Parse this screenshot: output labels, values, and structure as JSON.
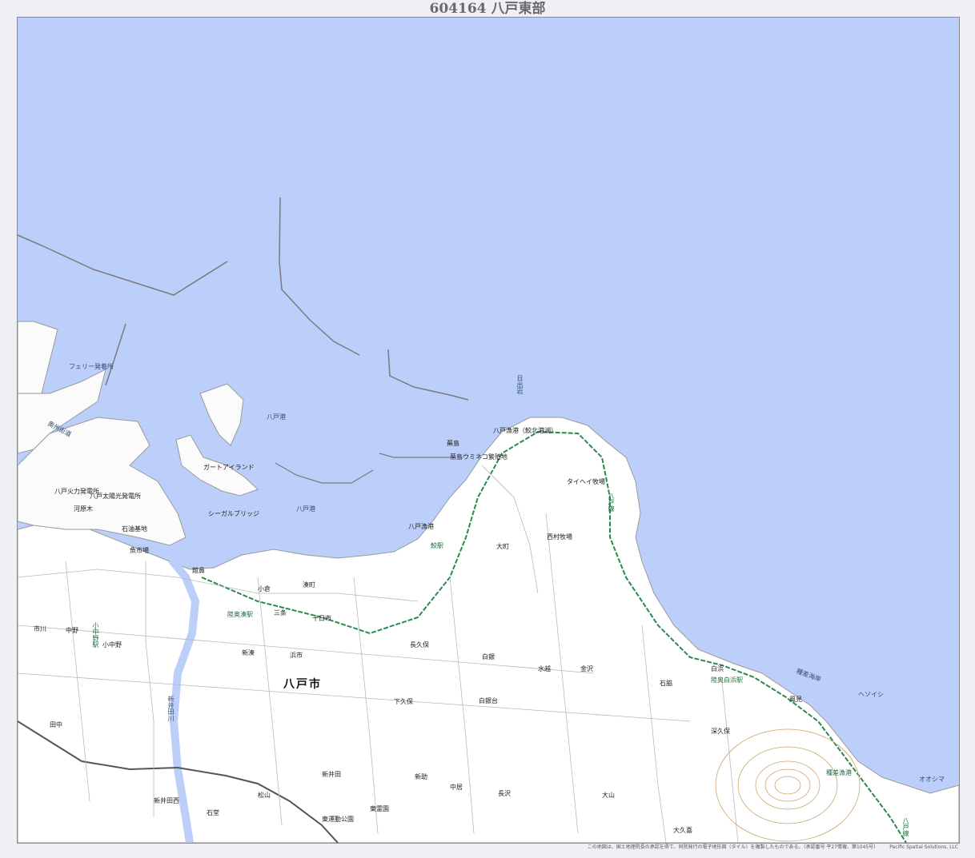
{
  "sheet": {
    "code": "604164",
    "name": "八戸東部"
  },
  "colors": {
    "sea": "#bccffb",
    "land": "#ffffff",
    "roads": "#9a9a9a",
    "railway": "#2b8a4e",
    "contours": "#c9a46a"
  },
  "labels": {
    "city": "八戸市",
    "hachinohe_port": "八戸港",
    "hachinohe_port2": "八戸港",
    "gate_island": "ガートアイランド",
    "seagull_bridge": "シーガルブリッジ",
    "ferry_terminal": "フェリー発着所",
    "kabushima": "蕪島",
    "kabushima_umineko": "蕪島ウミネコ繁殖地",
    "hachinohe_fishing_port_north": "八戸漁港（鮫北港湖）",
    "hachinohe_fishing_port_south": "八戸漁港",
    "hibiki": "日出岩",
    "hebiishi": "ヘソイシ",
    "oonishima": "オオシマ",
    "taipei_farm": "タイヘイ牧場",
    "nishimura_farm": "西村牧場",
    "tanesashi_coast": "種差海岸",
    "hachinohe_line_north": "八戸線",
    "hachinohe_line_south": "八戸線",
    "daikumaya": "大久喜",
    "samae_station": "鮫駅",
    "mutsuminato_station": "陸奥湊駅",
    "shirahama": "白浜",
    "mutsushirahama_station": "陸奥白浜駅",
    "isegamisaki": "石脇",
    "fukaho": "深久保",
    "hamachi": "浜市",
    "shinminato": "新湊",
    "minato": "湊町",
    "shirogane": "白銀",
    "shirogane_dai": "白銀台",
    "sanjo": "三条",
    "tosaka": "十日市",
    "nagawa": "長久保",
    "shimokubo": "下久保",
    "mizukoshi": "水越",
    "ooyama": "大山",
    "kanezawa": "金沢",
    "nakano": "中野",
    "konakano": "小中野",
    "konakano_station": "小中野駅",
    "shinmachi": "新井田",
    "shimoinuzawa": "新井田西",
    "matsuyama": "松山",
    "ishido": "石堂",
    "higashi_park": "東運動公園",
    "toei_park": "東霊園",
    "hachinohe_power": "八戸火力発電所",
    "taiheiyo_power": "八戸太陽光発電所",
    "sekiyu": "石油基地",
    "gyoshi": "魚市場",
    "tako": "館鼻",
    "kokura": "小倉",
    "mutsu_line": "奥州街道",
    "kawaguchi": "河原木",
    "ichikawa": "市川",
    "tagawa": "田中",
    "shin_iwata": "新井田川",
    "ohmachi": "大町",
    "hasegawa": "長沢",
    "shinsuke": "新助",
    "nakai": "中居",
    "kazami": "風見",
    "senbokuba": "種差漁港"
  },
  "footer": {
    "credit": "この地図は、国土地理院長の承認を得て、同院発行の電子地形図（タイル）を複製したものである。（承認番号 平27情複、第1045号）",
    "publisher": "Pacific Spatial Solutions, LLC"
  }
}
